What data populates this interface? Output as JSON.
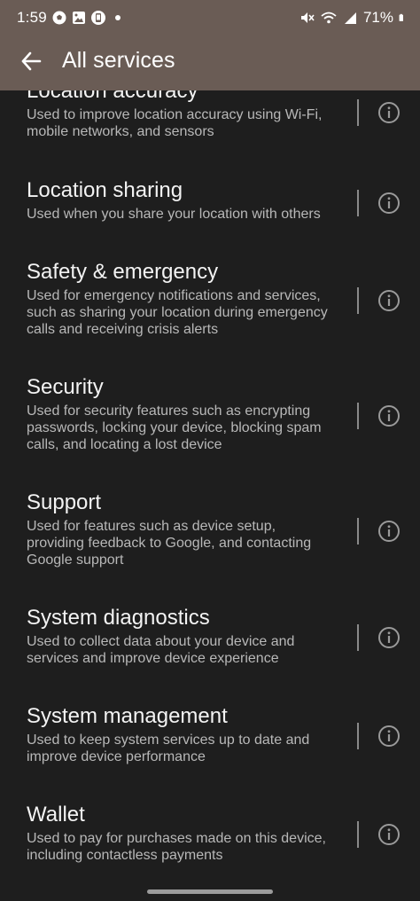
{
  "status": {
    "time": "1:59",
    "battery": "71%"
  },
  "appbar": {
    "title": "All services"
  },
  "services": [
    {
      "name": "Location accuracy",
      "desc": "Used to improve location accuracy using Wi-Fi, mobile networks, and sensors"
    },
    {
      "name": "Location sharing",
      "desc": "Used when you share your location with others"
    },
    {
      "name": "Safety & emergency",
      "desc": "Used for emergency notifications and services, such as sharing your location during emergency calls and receiving crisis alerts"
    },
    {
      "name": "Security",
      "desc": "Used for security features such as encrypting passwords, locking your device, blocking spam calls, and locating a lost device"
    },
    {
      "name": "Support",
      "desc": "Used for features such as device setup, providing feedback to Google, and contacting Google support"
    },
    {
      "name": "System diagnostics",
      "desc": "Used to collect data about your device and services and improve device experience"
    },
    {
      "name": "System management",
      "desc": "Used to keep system services up to date and improve device performance"
    },
    {
      "name": "Wallet",
      "desc": "Used to pay for purchases made on this device, including contactless payments"
    }
  ]
}
